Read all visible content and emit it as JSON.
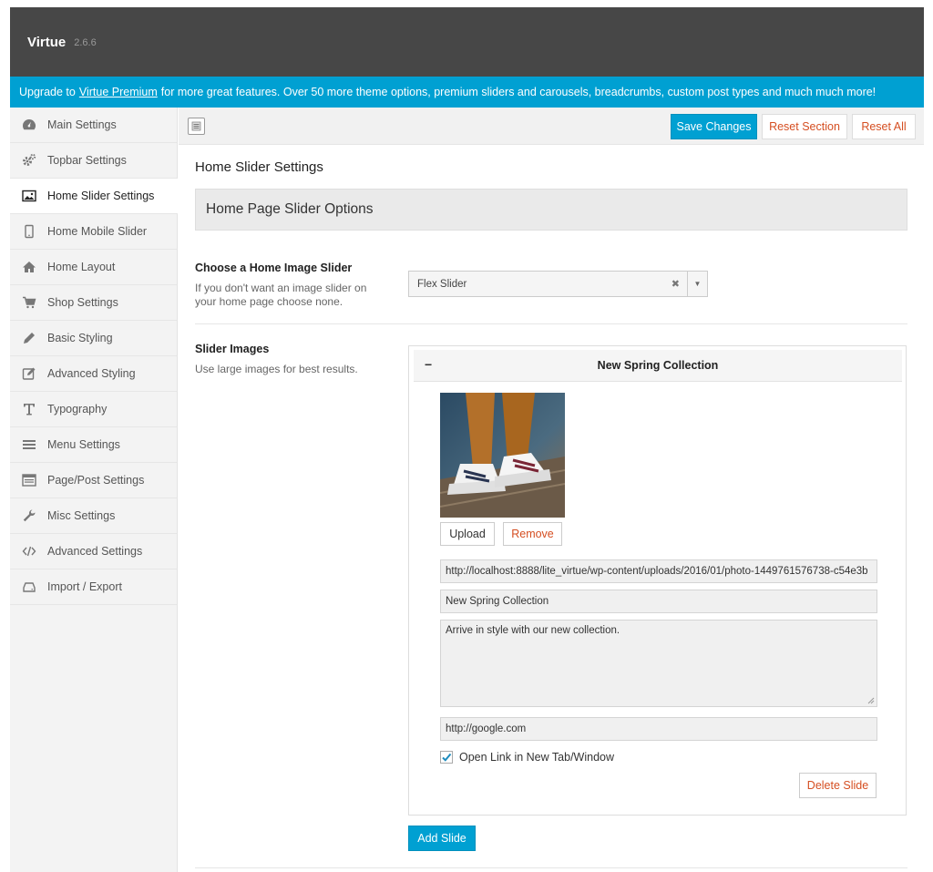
{
  "app": {
    "name": "Virtue",
    "version": "2.6.6"
  },
  "notice": {
    "prefix": "Upgrade to",
    "link_text": "Virtue Premium",
    "suffix": "for more great features. Over 50 more theme options, premium sliders and carousels, breadcrumbs, custom post types and much much more!"
  },
  "sidebar": {
    "items": [
      {
        "label": "Main Settings",
        "icon": "dashboard-icon"
      },
      {
        "label": "Topbar Settings",
        "icon": "cogs-icon"
      },
      {
        "label": "Home Slider Settings",
        "icon": "picture-icon",
        "active": true
      },
      {
        "label": "Home Mobile Slider",
        "icon": "mobile-icon"
      },
      {
        "label": "Home Layout",
        "icon": "home-icon"
      },
      {
        "label": "Shop Settings",
        "icon": "cart-icon"
      },
      {
        "label": "Basic Styling",
        "icon": "pencil-icon"
      },
      {
        "label": "Advanced Styling",
        "icon": "edit-icon"
      },
      {
        "label": "Typography",
        "icon": "text-icon"
      },
      {
        "label": "Menu Settings",
        "icon": "menu-icon"
      },
      {
        "label": "Page/Post Settings",
        "icon": "page-icon"
      },
      {
        "label": "Misc Settings",
        "icon": "wrench-icon"
      },
      {
        "label": "Advanced Settings",
        "icon": "code-icon"
      },
      {
        "label": "Import / Export",
        "icon": "drive-icon"
      }
    ]
  },
  "toolbar": {
    "save_label": "Save Changes",
    "reset_section_label": "Reset Section",
    "reset_all_label": "Reset All"
  },
  "main": {
    "section_title": "Home Slider Settings",
    "options_title": "Home Page Slider Options",
    "slider_field": {
      "label": "Choose a Home Image Slider",
      "description": "If you don't want an image slider on your home page choose none.",
      "value": "Flex Slider"
    },
    "images_field": {
      "label": "Slider Images",
      "description": "Use large images for best results."
    },
    "slide": {
      "title": "New Spring Collection",
      "upload_label": "Upload",
      "remove_label": "Remove",
      "url": "http://localhost:8888/lite_virtue/wp-content/uploads/2016/01/photo-1449761576738-c54e3b",
      "slide_title": "New Spring Collection",
      "description": "Arrive in style with our new collection.",
      "link": "http://google.com",
      "new_tab_label": "Open Link in New Tab/Window",
      "new_tab_checked": true,
      "delete_label": "Delete Slide"
    },
    "add_slide_label": "Add Slide"
  },
  "colors": {
    "accent": "#00a0d2",
    "danger": "#d54e21",
    "header": "#474747"
  }
}
